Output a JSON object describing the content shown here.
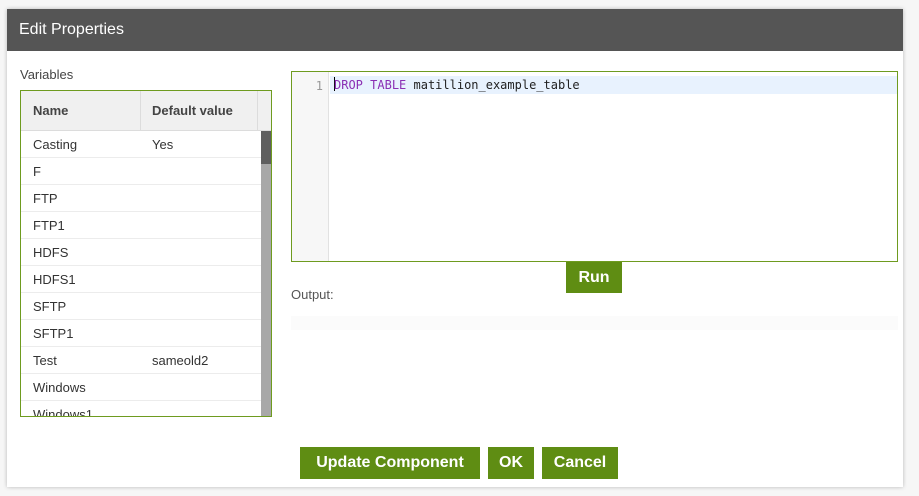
{
  "dialog": {
    "title": "Edit Properties"
  },
  "variables": {
    "label": "Variables",
    "columns": [
      "Name",
      "Default value"
    ],
    "rows": [
      {
        "name": "Casting",
        "default": "Yes"
      },
      {
        "name": "F",
        "default": ""
      },
      {
        "name": "FTP",
        "default": ""
      },
      {
        "name": "FTP1",
        "default": ""
      },
      {
        "name": "HDFS",
        "default": ""
      },
      {
        "name": "HDFS1",
        "default": ""
      },
      {
        "name": "SFTP",
        "default": ""
      },
      {
        "name": "SFTP1",
        "default": ""
      },
      {
        "name": "Test",
        "default": "sameold2"
      },
      {
        "name": "Windows",
        "default": ""
      },
      {
        "name": "Windows1",
        "default": ""
      }
    ]
  },
  "editor": {
    "line_number": "1",
    "code": {
      "kw1": "DROP",
      "kw2": "TABLE",
      "rest": " matillion_example_table"
    }
  },
  "run_button": "Run",
  "output": {
    "label": "Output:"
  },
  "footer": {
    "update_label": "Update Component",
    "ok_label": "OK",
    "cancel_label": "Cancel"
  },
  "colors": {
    "accent": "#5f8d13",
    "titlebar": "#555555",
    "keyword": "#8b2fb4"
  }
}
